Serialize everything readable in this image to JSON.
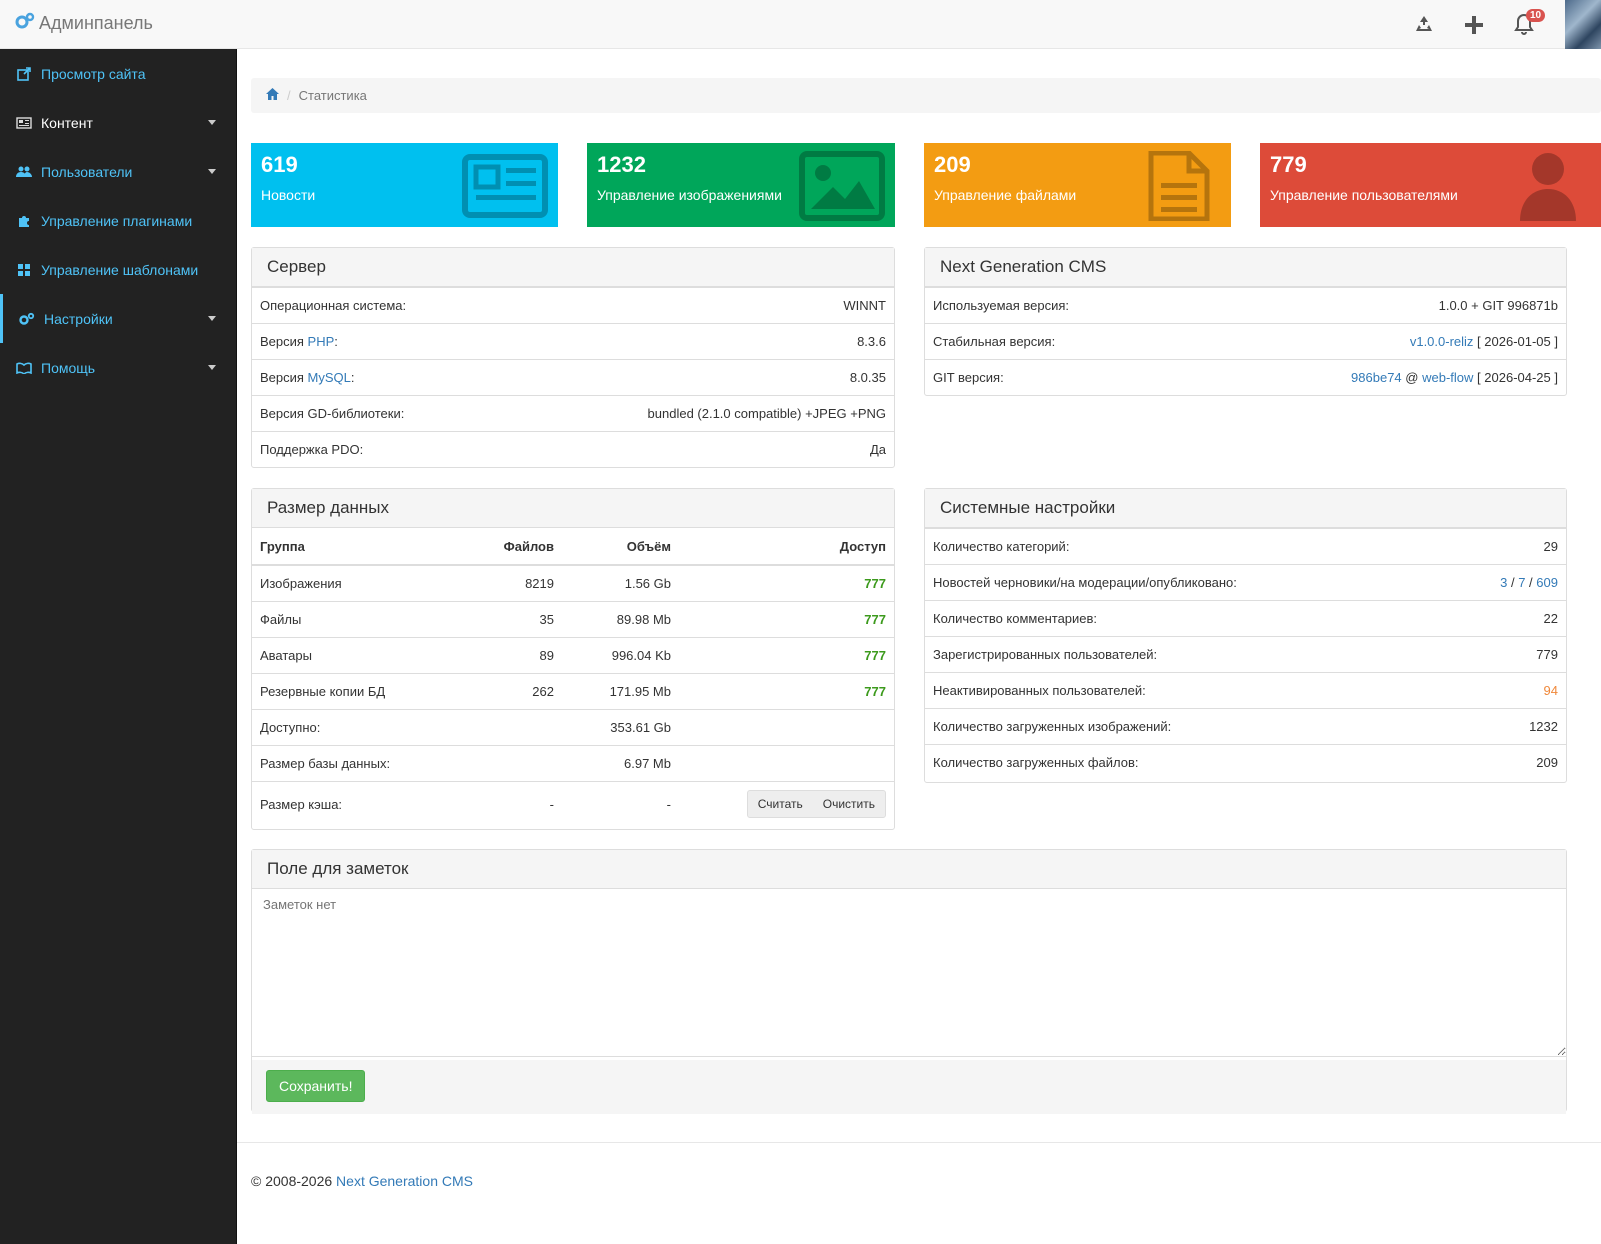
{
  "header": {
    "title": "Админпанель",
    "notifications_count": "10"
  },
  "sidebar": {
    "items": [
      {
        "label": "Просмотр сайта"
      },
      {
        "label": "Контент"
      },
      {
        "label": "Пользователи"
      },
      {
        "label": "Управление плагинами"
      },
      {
        "label": "Управление шаблонами"
      },
      {
        "label": "Настройки"
      },
      {
        "label": "Помощь"
      }
    ]
  },
  "breadcrumb": {
    "current": "Статистика"
  },
  "stats": [
    {
      "num": "619",
      "label": "Новости",
      "color": "#00c0ef"
    },
    {
      "num": "1232",
      "label": "Управление изображениями",
      "color": "#00a65a"
    },
    {
      "num": "209",
      "label": "Управление файлами",
      "color": "#f39c12"
    },
    {
      "num": "779",
      "label": "Управление пользователями",
      "color": "#dd4b39"
    }
  ],
  "server": {
    "title": "Сервер",
    "os_label": "Операционная система:",
    "os": "WINNT",
    "php_prefix": "Версия ",
    "php_link": "PHP",
    "php_suffix": ":",
    "php": "8.3.6",
    "mysql_prefix": "Версия ",
    "mysql_link": "MySQL",
    "mysql_suffix": ":",
    "mysql": "8.0.35",
    "gd_label": "Версия GD-библиотеки:",
    "gd": "bundled (2.1.0 compatible) +JPEG +PNG",
    "pdo_label": "Поддержка PDO:",
    "pdo": "Да"
  },
  "cms": {
    "title": "Next Generation CMS",
    "used_label": "Используемая версия:",
    "used": "1.0.0 + GIT 996871b",
    "stable_label": "Стабильная версия:",
    "stable_link": "v1.0.0-reliz",
    "stable_date": "[ 2026-01-05 ]",
    "git_label": "GIT версия:",
    "git_hash": "986be74",
    "git_at": "@",
    "git_branch": "web-flow",
    "git_date": "[ 2026-04-25 ]"
  },
  "datasize": {
    "title": "Размер данных",
    "headers": {
      "group": "Группа",
      "files": "Файлов",
      "volume": "Объём",
      "access": "Доступ"
    },
    "rows": [
      {
        "group": "Изображения",
        "files": "8219",
        "volume": "1.56 Gb",
        "access": "777"
      },
      {
        "group": "Файлы",
        "files": "35",
        "volume": "89.98 Mb",
        "access": "777"
      },
      {
        "group": "Аватары",
        "files": "89",
        "volume": "996.04 Kb",
        "access": "777"
      },
      {
        "group": "Резервные копии БД",
        "files": "262",
        "volume": "171.95 Mb",
        "access": "777"
      }
    ],
    "available_label": "Доступно:",
    "available": "353.61 Gb",
    "db_label": "Размер базы данных:",
    "db": "6.97 Mb",
    "cache_label": "Размер кэша:",
    "cache_files": "-",
    "cache_volume": "-",
    "count_btn": "Считать",
    "clear_btn": "Очистить"
  },
  "sys": {
    "title": "Системные настройки",
    "cats_label": "Количество категорий:",
    "cats": "29",
    "news_label": "Новостей черновики/на модерации/опубликовано:",
    "news_draft": "3",
    "news_mod": "7",
    "news_pub": "609",
    "slash": "/",
    "comments_label": "Количество комментариев:",
    "comments": "22",
    "reg_label": "Зарегистрированных пользователей:",
    "reg": "779",
    "inactive_label": "Неактивированных пользователей:",
    "inactive": "94",
    "images_label": "Количество загруженных изображений:",
    "images": "1232",
    "files_label": "Количество загруженных файлов:",
    "files": "209"
  },
  "notes": {
    "title": "Поле для заметок",
    "placeholder": "Заметок нет",
    "save": "Сохранить!"
  },
  "footer": {
    "copyright": "© 2008-2026 ",
    "link": "Next Generation CMS"
  }
}
